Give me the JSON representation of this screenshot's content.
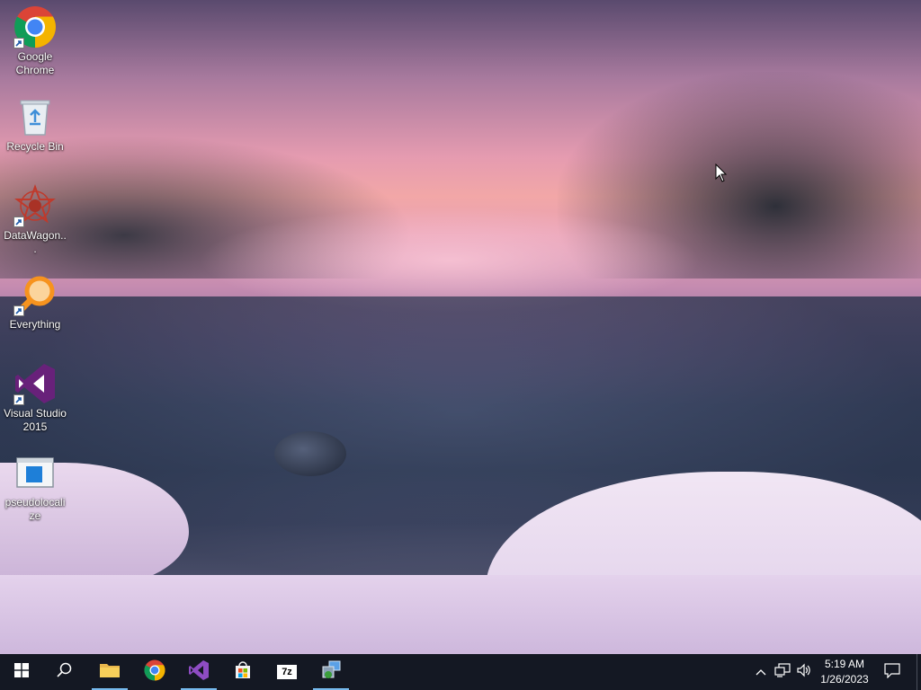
{
  "desktop": {
    "icons": [
      {
        "label": "Google Chrome",
        "icon": "chrome-icon"
      },
      {
        "label": "Recycle Bin",
        "icon": "recycle-bin-icon"
      },
      {
        "label": "DataWagon...",
        "icon": "datawagon-icon"
      },
      {
        "label": "Everything",
        "icon": "everything-search-icon"
      },
      {
        "label": "Visual Studio 2015",
        "icon": "visual-studio-icon"
      },
      {
        "label": "pseudolocalize",
        "icon": "app-window-icon"
      }
    ]
  },
  "taskbar": {
    "pinned": [
      {
        "name": "File Explorer",
        "icon": "folder-icon",
        "running": true
      },
      {
        "name": "Google Chrome",
        "icon": "chrome-icon",
        "running": false
      },
      {
        "name": "Visual Studio",
        "icon": "visual-studio-icon",
        "running": true
      },
      {
        "name": "Microsoft Store",
        "icon": "store-icon",
        "running": false
      },
      {
        "name": "7-Zip",
        "icon": "7zip-icon",
        "running": false
      },
      {
        "name": "Installer",
        "icon": "installer-icon",
        "running": true
      }
    ],
    "zip_label": "7z",
    "clock": {
      "time": "5:19 AM",
      "date": "1/26/2023"
    }
  },
  "colors": {
    "taskbar": "#141823",
    "running_indicator": "#76b9ed",
    "chrome_red": "#db4437",
    "chrome_yellow": "#f4b400",
    "chrome_green": "#0f9d58",
    "chrome_blue": "#4285f4",
    "vs_purple": "#68217a",
    "everything_orange": "#f7931e"
  }
}
